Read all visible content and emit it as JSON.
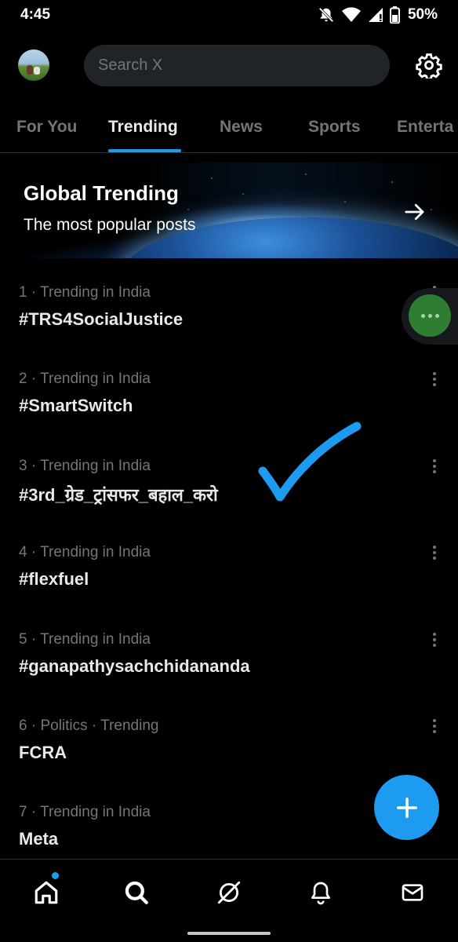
{
  "status_bar": {
    "time": "4:45",
    "battery": "50%"
  },
  "header": {
    "search_placeholder": "Search X"
  },
  "tabs": [
    {
      "label": "For You"
    },
    {
      "label": "Trending"
    },
    {
      "label": "News"
    },
    {
      "label": "Sports"
    },
    {
      "label": "Enterta"
    }
  ],
  "active_tab": "Trending",
  "banner": {
    "title": "Global Trending",
    "subtitle": "The most popular posts"
  },
  "trends": [
    {
      "meta": "1 · Trending in India",
      "name": "#TRS4SocialJustice"
    },
    {
      "meta": "2 · Trending in India",
      "name": "#SmartSwitch"
    },
    {
      "meta": "3 · Trending in India",
      "name": "#3rd_ग्रेड_ट्रांसफर_बहाल_करो"
    },
    {
      "meta": "4 · Trending in India",
      "name": "#flexfuel"
    },
    {
      "meta": "5 · Trending in India",
      "name": "#ganapathysachchidananda"
    },
    {
      "meta": "6 · Politics · Trending",
      "name": "FCRA"
    },
    {
      "meta": "7 · Trending in India",
      "name": "Meta"
    }
  ],
  "bottom_nav": [
    {
      "icon": "home-icon"
    },
    {
      "icon": "search-icon"
    },
    {
      "icon": "grok-icon"
    },
    {
      "icon": "bell-icon"
    },
    {
      "icon": "mail-icon"
    }
  ],
  "colors": {
    "accent": "#1d9bf0",
    "text": "#e7e9ea",
    "muted": "#71767b",
    "background": "#000000"
  }
}
